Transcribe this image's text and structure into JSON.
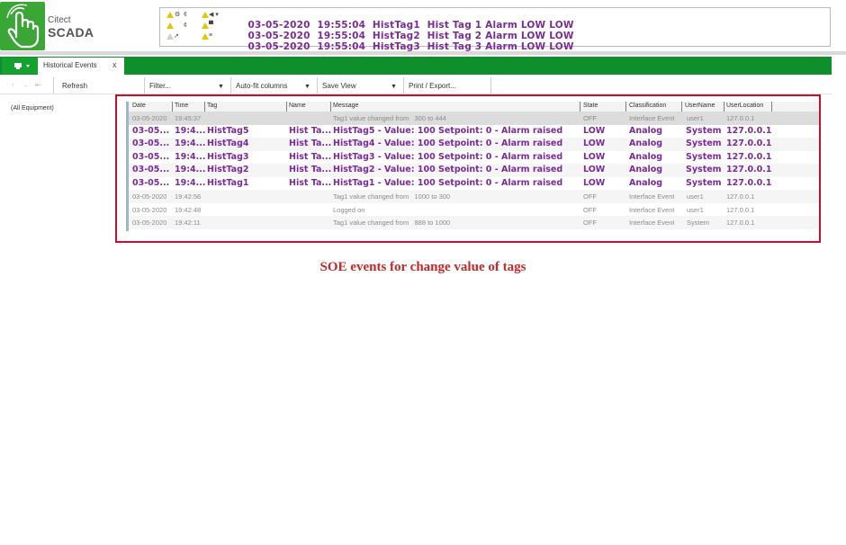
{
  "brand": {
    "line1": "Citect",
    "line2": "SCADA",
    "color": "#3aa635"
  },
  "banner": {
    "alarms": [
      {
        "date": "03-05-2020",
        "time": "19:55:04",
        "tag": "HistTag1",
        "desc": "Hist Tag 1 Alarm LOW LOW"
      },
      {
        "date": "03-05-2020",
        "time": "19:55:04",
        "tag": "HistTag2",
        "desc": "Hist Tag 2 Alarm LOW LOW"
      },
      {
        "date": "03-05-2020",
        "time": "19:55:04",
        "tag": "HistTag3",
        "desc": "Hist Tag 3 Alarm LOW LOW"
      }
    ],
    "alarm_color": "#7b2a9a"
  },
  "tabs": {
    "active_label": "Historical Events",
    "close_glyph": "x"
  },
  "toolbar": {
    "refresh": "Refresh",
    "filter": "Filter...",
    "autofit": "Auto-fit columns",
    "saveview": "Save View",
    "print": "Print / Export..."
  },
  "tree": {
    "root": "(All Equipment)"
  },
  "grid": {
    "headers": {
      "date": "Date",
      "time": "Time",
      "tag": "Tag",
      "name": "Name",
      "message": "Message",
      "state": "State",
      "classification": "Classification",
      "username": "UserName",
      "userlocation": "UserLocation"
    },
    "rows": [
      {
        "date": "03-05-2020",
        "time": "19:45:37",
        "tag": "",
        "name": "",
        "message": "Tag1 value changed from   300 to 444",
        "state": "OFF",
        "classification": "Interface Event",
        "username": "user1",
        "location": "127.0.0.1"
      },
      {
        "date": "03-05...",
        "time": "19:4...",
        "tag": "HistTag5",
        "name": "Hist Ta...",
        "message": "HistTag5 - Value: 100 Setpoint: 0 - Alarm raised",
        "state": "LOW",
        "classification": "Analog",
        "username": "System",
        "location": "127.0.0.1"
      },
      {
        "date": "03-05...",
        "time": "19:4...",
        "tag": "HistTag4",
        "name": "Hist Ta...",
        "message": "HistTag4 - Value: 100 Setpoint: 0 - Alarm raised",
        "state": "LOW",
        "classification": "Analog",
        "username": "System",
        "location": "127.0.0.1"
      },
      {
        "date": "03-05...",
        "time": "19:4...",
        "tag": "HistTag3",
        "name": "Hist Ta...",
        "message": "HistTag3 - Value: 100 Setpoint: 0 - Alarm raised",
        "state": "LOW",
        "classification": "Analog",
        "username": "System",
        "location": "127.0.0.1"
      },
      {
        "date": "03-05...",
        "time": "19:4...",
        "tag": "HistTag2",
        "name": "Hist Ta...",
        "message": "HistTag2 - Value: 100 Setpoint: 0 - Alarm raised",
        "state": "LOW",
        "classification": "Analog",
        "username": "System",
        "location": "127.0.0.1"
      },
      {
        "date": "03-05...",
        "time": "19:4...",
        "tag": "HistTag1",
        "name": "Hist Ta...",
        "message": "HistTag1 - Value: 100 Setpoint: 0 - Alarm raised",
        "state": "LOW",
        "classification": "Analog",
        "username": "System",
        "location": "127.0.0.1"
      },
      {
        "date": "03-05-2020",
        "time": "19:42:56",
        "tag": "",
        "name": "",
        "message": "Tag1 value changed from   1000 to 300",
        "state": "OFF",
        "classification": "Interface Event",
        "username": "user1",
        "location": "127.0.0.1"
      },
      {
        "date": "03-05-2020",
        "time": "19:42:48",
        "tag": "",
        "name": "",
        "message": "Logged on",
        "state": "OFF",
        "classification": "Interface Event",
        "username": "user1",
        "location": "127.0.0.1"
      },
      {
        "date": "03-05-2020",
        "time": "19:42:11",
        "tag": "",
        "name": "",
        "message": "Tag1 value changed from   888 to 1000",
        "state": "OFF",
        "classification": "Interface Event",
        "username": "System",
        "location": "127.0.0.1"
      }
    ]
  },
  "caption": "SOE events for change value of tags",
  "colors": {
    "tabbar": "#0e8f2c",
    "highlight_frame": "#c8102e",
    "caption": "#c62828"
  }
}
